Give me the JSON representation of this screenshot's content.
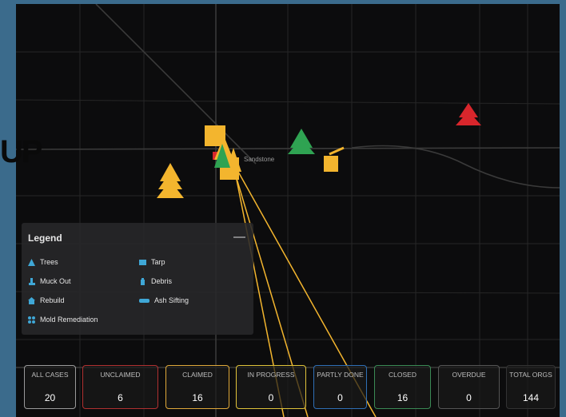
{
  "overlay_text": "UP",
  "map": {
    "street_label": "Sandstone"
  },
  "legend": {
    "title": "Legend",
    "collapse_label": "—",
    "items": [
      {
        "label": "Trees",
        "icon": "tree-icon",
        "color": "#3fa7d6"
      },
      {
        "label": "Tarp",
        "icon": "tarp-icon",
        "color": "#3fa7d6"
      },
      {
        "label": "Muck Out",
        "icon": "boot-icon",
        "color": "#3fa7d6"
      },
      {
        "label": "Debris",
        "icon": "debris-icon",
        "color": "#3fa7d6"
      },
      {
        "label": "Rebuild",
        "icon": "house-icon",
        "color": "#3fa7d6"
      },
      {
        "label": "Ash Sifting",
        "icon": "ash-sifting-icon",
        "color": "#3fa7d6"
      },
      {
        "label": "Mold Remediation",
        "icon": "mold-icon",
        "color": "#3fa7d6"
      }
    ]
  },
  "stats": [
    {
      "label": "ALL CASES",
      "value": "20",
      "border": "#9a9a9a"
    },
    {
      "label": "UNCLAIMED",
      "value": "6",
      "border": "#b03030"
    },
    {
      "label": "CLAIMED",
      "value": "16",
      "border": "#e0a93a"
    },
    {
      "label": "IN PROGRESS",
      "value": "0",
      "border": "#e0c33a"
    },
    {
      "label": "PARTLY DONE",
      "value": "0",
      "border": "#2f6fb5"
    },
    {
      "label": "CLOSED",
      "value": "16",
      "border": "#3a8a55"
    },
    {
      "label": "OVERDUE",
      "value": "0",
      "border": "#555555"
    },
    {
      "label": "TOTAL ORGS",
      "value": "144",
      "border": "#333333"
    }
  ],
  "colors": {
    "claimed": "#f3b52e",
    "unclaimed": "#d8262c",
    "closed": "#2fa352"
  }
}
